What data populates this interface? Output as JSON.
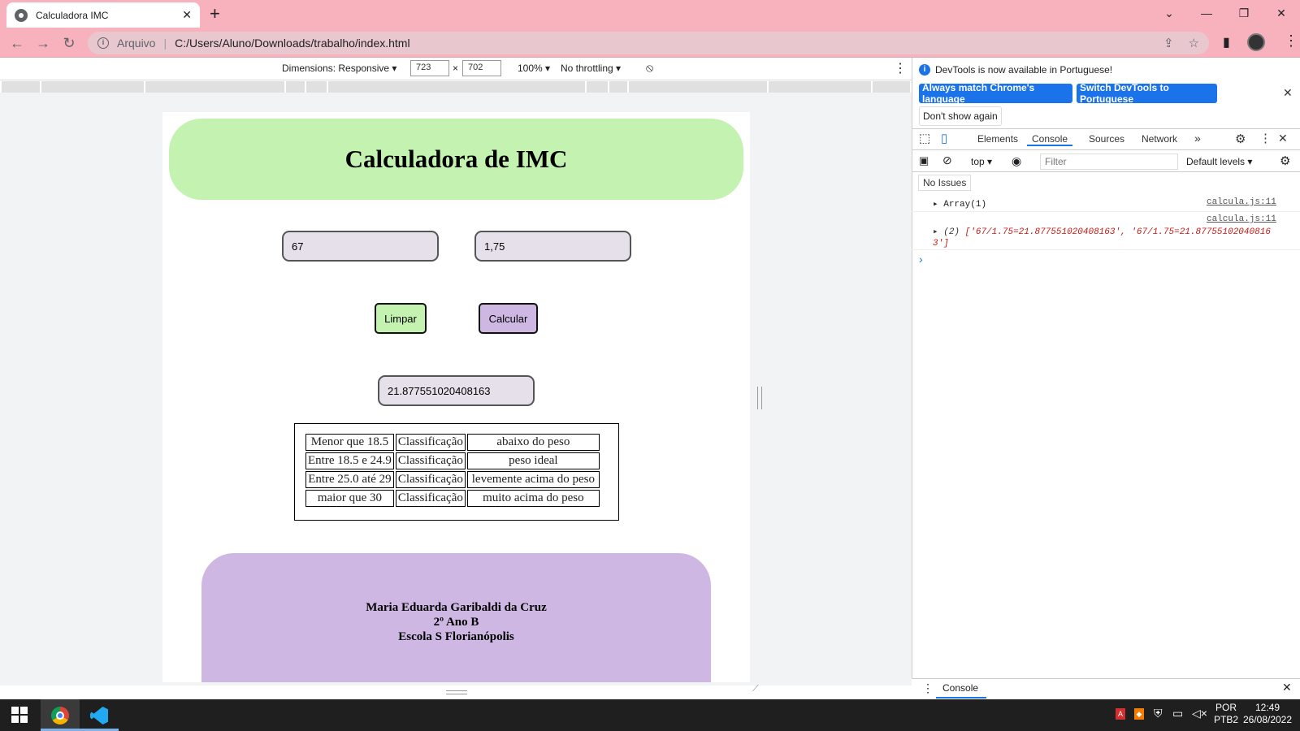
{
  "browser": {
    "tab_title": "Calculadora IMC",
    "tab_close": "✕",
    "new_tab": "+",
    "security_label": "Arquivo",
    "url": "C:/Users/Aluno/Downloads/trabalho/index.html"
  },
  "device_toolbar": {
    "dimensions_label": "Dimensions: Responsive",
    "width": "723",
    "times": "×",
    "height": "702",
    "zoom": "100%",
    "throttling": "No throttling"
  },
  "page": {
    "title": "Calculadora de IMC",
    "peso_value": "67",
    "altura_value": "1,75",
    "limpar_label": "Limpar",
    "calcular_label": "Calcular",
    "resultado_value": "21.877551020408163",
    "table": [
      [
        "Menor que 18.5",
        "Classificação",
        "abaixo do peso"
      ],
      [
        "Entre 18.5 e 24.9",
        "Classificação",
        "peso ideal"
      ],
      [
        "Entre 25.0 até 29",
        "Classificação",
        "levemente acima do peso"
      ],
      [
        "maior que 30",
        "Classificação",
        "muito acima do peso"
      ]
    ],
    "footer": {
      "name": "Maria Eduarda Garibaldi da Cruz",
      "class": "2º Ano B",
      "school": "Escola S Florianópolis"
    }
  },
  "devtools": {
    "notice": "DevTools is now available in Portuguese!",
    "match_lang_btn": "Always match Chrome's language",
    "switch_btn": "Switch DevTools to Portuguese",
    "dont_show_btn": "Don't show again",
    "tabs": [
      "Elements",
      "Console",
      "Sources",
      "Network"
    ],
    "more_tabs": "»",
    "context": "top",
    "filter_placeholder": "Filter",
    "levels": "Default levels",
    "no_issues": "No Issues",
    "log1_text": "Array(1)",
    "log1_src": "calcula.js:11",
    "log2_src": "calcula.js:11",
    "log2_count": "(2)",
    "log2_text": "['67/1.75=21.877551020408163', '67/1.75=21.877551020408163']",
    "prompt": "›",
    "drawer_tab": "Console"
  },
  "taskbar": {
    "lang_top": "POR",
    "lang_bottom": "PTB2",
    "time": "12:49",
    "date": "26/08/2022"
  },
  "colors": {
    "chrome_frame": "#f7b2bd",
    "header_bg": "#c4f2b0",
    "footer_bg": "#cfb7e3",
    "limpar_bg": "#c4f2b0",
    "calcular_bg": "#cfb7e3",
    "devtools_blue": "#1a73e8"
  }
}
